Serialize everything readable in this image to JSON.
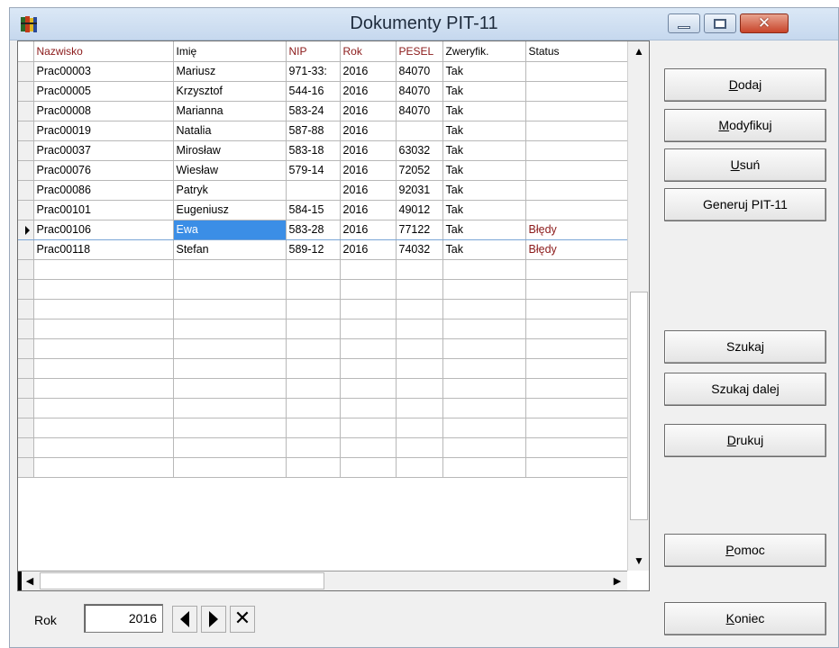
{
  "window": {
    "title": "Dokumenty PIT-11",
    "close_glyph": "✕",
    "icon": "app-icon"
  },
  "grid": {
    "columns": [
      "Nazwisko",
      "Imię",
      "NIP",
      "Rok",
      "PESEL",
      "Zweryfik.",
      "Status"
    ],
    "rows": [
      {
        "nazwisko": "Prac00003",
        "imie": "Mariusz",
        "nip": "971-33:",
        "rok": "2016",
        "pesel": "84070",
        "zweryfik": "Tak",
        "status": ""
      },
      {
        "nazwisko": "Prac00005",
        "imie": "Krzysztof",
        "nip": "544-16",
        "rok": "2016",
        "pesel": "84070",
        "zweryfik": "Tak",
        "status": ""
      },
      {
        "nazwisko": "Prac00008",
        "imie": "Marianna",
        "nip": "583-24",
        "rok": "2016",
        "pesel": "84070",
        "zweryfik": "Tak",
        "status": ""
      },
      {
        "nazwisko": "Prac00019",
        "imie": "Natalia",
        "nip": "587-88",
        "rok": "2016",
        "pesel": "",
        "zweryfik": "Tak",
        "status": ""
      },
      {
        "nazwisko": "Prac00037",
        "imie": "Mirosław",
        "nip": "583-18",
        "rok": "2016",
        "pesel": "63032",
        "zweryfik": "Tak",
        "status": ""
      },
      {
        "nazwisko": "Prac00076",
        "imie": "Wiesław",
        "nip": "579-14",
        "rok": "2016",
        "pesel": "72052",
        "zweryfik": "Tak",
        "status": ""
      },
      {
        "nazwisko": "Prac00086",
        "imie": "Patryk",
        "nip": "",
        "rok": "2016",
        "pesel": "92031",
        "zweryfik": "Tak",
        "status": ""
      },
      {
        "nazwisko": "Prac00101",
        "imie": "Eugeniusz",
        "nip": "584-15",
        "rok": "2016",
        "pesel": "49012",
        "zweryfik": "Tak",
        "status": ""
      },
      {
        "nazwisko": "Prac00106",
        "imie": "Ewa",
        "nip": "583-28",
        "rok": "2016",
        "pesel": "77122",
        "zweryfik": "Tak",
        "status": "Błędy"
      },
      {
        "nazwisko": "Prac00118",
        "imie": "Stefan",
        "nip": "589-12",
        "rok": "2016",
        "pesel": "74032",
        "zweryfik": "Tak",
        "status": "Błędy"
      }
    ],
    "selected_row": 8,
    "empty_rows": 11
  },
  "buttons": {
    "dodaj": {
      "pre": "",
      "u": "D",
      "post": "odaj"
    },
    "modyfikuj": {
      "pre": "",
      "u": "M",
      "post": "odyfikuj"
    },
    "usun": {
      "pre": "",
      "u": "U",
      "post": "suń"
    },
    "generuj": "Generuj PIT-11",
    "szukaj": "Szukaj",
    "szukaj_dalej": "Szukaj dalej",
    "drukuj": {
      "pre": "",
      "u": "D",
      "post": "rukuj"
    },
    "pomoc": {
      "pre": "",
      "u": "P",
      "post": "omoc"
    },
    "koniec": {
      "pre": "",
      "u": "K",
      "post": "oniec"
    }
  },
  "footer": {
    "rok_label": "Rok",
    "rok_value": "2016",
    "clear_glyph": "✕"
  },
  "colors": {
    "header_red": "#8b1a1a",
    "selection_blue": "#3b8ee6",
    "error_text": "#8b1a1a"
  }
}
